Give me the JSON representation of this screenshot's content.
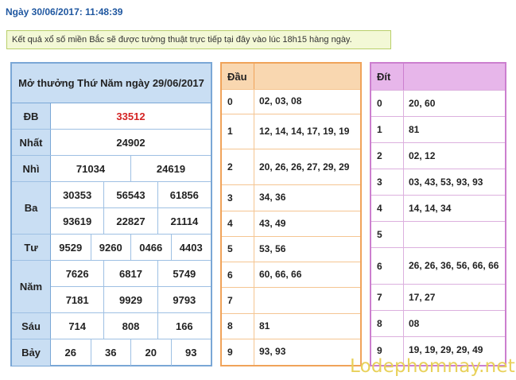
{
  "header": {
    "datetime": "Ngày 30/06/2017: 11:48:39"
  },
  "notice": "Kết quả xổ số miền Bắc sẽ được tường thuật trực tiếp tại đây vào lúc 18h15 hàng ngày.",
  "results": {
    "title": "Mở thưởng Thứ Năm ngày 29/06/2017",
    "prizes": [
      {
        "label": "ĐB",
        "rows": [
          [
            "33512"
          ]
        ]
      },
      {
        "label": "Nhất",
        "rows": [
          [
            "24902"
          ]
        ]
      },
      {
        "label": "Nhì",
        "rows": [
          [
            "71034",
            "24619"
          ]
        ]
      },
      {
        "label": "Ba",
        "rows": [
          [
            "30353",
            "56543",
            "61856"
          ],
          [
            "93619",
            "22827",
            "21114"
          ]
        ]
      },
      {
        "label": "Tư",
        "rows": [
          [
            "9529",
            "9260",
            "0466",
            "4403"
          ]
        ]
      },
      {
        "label": "Năm",
        "rows": [
          [
            "7626",
            "6817",
            "5749"
          ],
          [
            "7181",
            "9929",
            "9793"
          ]
        ]
      },
      {
        "label": "Sáu",
        "rows": [
          [
            "714",
            "808",
            "166"
          ]
        ]
      },
      {
        "label": "Bảy",
        "rows": [
          [
            "26",
            "36",
            "20",
            "93"
          ]
        ]
      }
    ]
  },
  "dau_table": {
    "header": "Đầu",
    "rows": [
      {
        "k": "0",
        "v": "02, 03, 08"
      },
      {
        "k": "1",
        "v": "12, 14, 14, 17, 19, 19"
      },
      {
        "k": "2",
        "v": "20, 26, 26, 27, 29, 29"
      },
      {
        "k": "3",
        "v": "34, 36"
      },
      {
        "k": "4",
        "v": "43, 49"
      },
      {
        "k": "5",
        "v": "53, 56"
      },
      {
        "k": "6",
        "v": "60, 66, 66"
      },
      {
        "k": "7",
        "v": ""
      },
      {
        "k": "8",
        "v": "81"
      },
      {
        "k": "9",
        "v": "93, 93"
      }
    ]
  },
  "dit_table": {
    "header": "Đít",
    "rows": [
      {
        "k": "0",
        "v": "20, 60"
      },
      {
        "k": "1",
        "v": "81"
      },
      {
        "k": "2",
        "v": "02, 12"
      },
      {
        "k": "3",
        "v": "03, 43, 53, 93, 93"
      },
      {
        "k": "4",
        "v": "14, 14, 34"
      },
      {
        "k": "5",
        "v": ""
      },
      {
        "k": "6",
        "v": "26, 26, 36, 56, 66, 66"
      },
      {
        "k": "7",
        "v": "17, 27"
      },
      {
        "k": "8",
        "v": "08"
      },
      {
        "k": "9",
        "v": "19, 19, 29, 29, 49"
      }
    ]
  },
  "watermark": "Lodephomnay.net",
  "colors": {
    "special_prize": "#d42323",
    "results_border": "#7aa7d6",
    "dau_border": "#f0a35a",
    "dit_border": "#cc7fcf"
  }
}
